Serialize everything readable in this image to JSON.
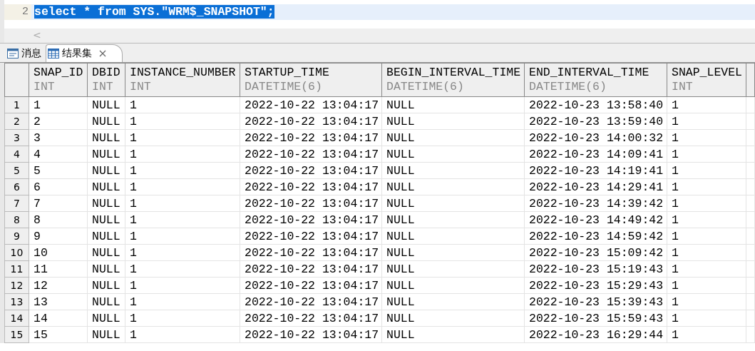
{
  "editor": {
    "lines": [
      {
        "number": "2",
        "code": "select * from SYS.\"WRM$_SNAPSHOT\";",
        "current": true,
        "selected": true
      }
    ],
    "scroll_left": "<"
  },
  "tabs": [
    {
      "label": "消息",
      "kind": "messages",
      "selected": false,
      "closable": false
    },
    {
      "label": "结果集",
      "kind": "grid",
      "selected": true,
      "closable": true
    }
  ],
  "table": {
    "columns": [
      {
        "name": "SNAP_ID",
        "type": "INT"
      },
      {
        "name": "DBID",
        "type": "INT"
      },
      {
        "name": "INSTANCE_NUMBER",
        "type": "INT"
      },
      {
        "name": "STARTUP_TIME",
        "type": "DATETIME(6)"
      },
      {
        "name": "BEGIN_INTERVAL_TIME",
        "type": "DATETIME(6)"
      },
      {
        "name": "END_INTERVAL_TIME",
        "type": "DATETIME(6)"
      },
      {
        "name": "SNAP_LEVEL",
        "type": "INT"
      }
    ],
    "rows": [
      {
        "number": "1",
        "cells": [
          "1",
          "NULL",
          "1",
          "2022-10-22 13:04:17",
          "NULL",
          "2022-10-23 13:58:40",
          "1"
        ]
      },
      {
        "number": "2",
        "cells": [
          "2",
          "NULL",
          "1",
          "2022-10-22 13:04:17",
          "NULL",
          "2022-10-23 13:59:40",
          "1"
        ]
      },
      {
        "number": "3",
        "cells": [
          "3",
          "NULL",
          "1",
          "2022-10-22 13:04:17",
          "NULL",
          "2022-10-23 14:00:32",
          "1"
        ]
      },
      {
        "number": "4",
        "cells": [
          "4",
          "NULL",
          "1",
          "2022-10-22 13:04:17",
          "NULL",
          "2022-10-23 14:09:41",
          "1"
        ]
      },
      {
        "number": "5",
        "cells": [
          "5",
          "NULL",
          "1",
          "2022-10-22 13:04:17",
          "NULL",
          "2022-10-23 14:19:41",
          "1"
        ]
      },
      {
        "number": "6",
        "cells": [
          "6",
          "NULL",
          "1",
          "2022-10-22 13:04:17",
          "NULL",
          "2022-10-23 14:29:41",
          "1"
        ]
      },
      {
        "number": "7",
        "cells": [
          "7",
          "NULL",
          "1",
          "2022-10-22 13:04:17",
          "NULL",
          "2022-10-23 14:39:42",
          "1"
        ]
      },
      {
        "number": "8",
        "cells": [
          "8",
          "NULL",
          "1",
          "2022-10-22 13:04:17",
          "NULL",
          "2022-10-23 14:49:42",
          "1"
        ]
      },
      {
        "number": "9",
        "cells": [
          "9",
          "NULL",
          "1",
          "2022-10-22 13:04:17",
          "NULL",
          "2022-10-23 14:59:42",
          "1"
        ]
      },
      {
        "number": "10",
        "cells": [
          "10",
          "NULL",
          "1",
          "2022-10-22 13:04:17",
          "NULL",
          "2022-10-23 15:09:42",
          "1"
        ]
      },
      {
        "number": "11",
        "cells": [
          "11",
          "NULL",
          "1",
          "2022-10-22 13:04:17",
          "NULL",
          "2022-10-23 15:19:43",
          "1"
        ]
      },
      {
        "number": "12",
        "cells": [
          "12",
          "NULL",
          "1",
          "2022-10-22 13:04:17",
          "NULL",
          "2022-10-23 15:29:43",
          "1"
        ]
      },
      {
        "number": "13",
        "cells": [
          "13",
          "NULL",
          "1",
          "2022-10-22 13:04:17",
          "NULL",
          "2022-10-23 15:39:43",
          "1"
        ]
      },
      {
        "number": "14",
        "cells": [
          "14",
          "NULL",
          "1",
          "2022-10-22 13:04:17",
          "NULL",
          "2022-10-23 15:59:43",
          "1"
        ]
      },
      {
        "number": "15",
        "cells": [
          "15",
          "NULL",
          "1",
          "2022-10-22 13:04:17",
          "NULL",
          "2022-10-23 16:29:44",
          "1"
        ]
      }
    ]
  }
}
